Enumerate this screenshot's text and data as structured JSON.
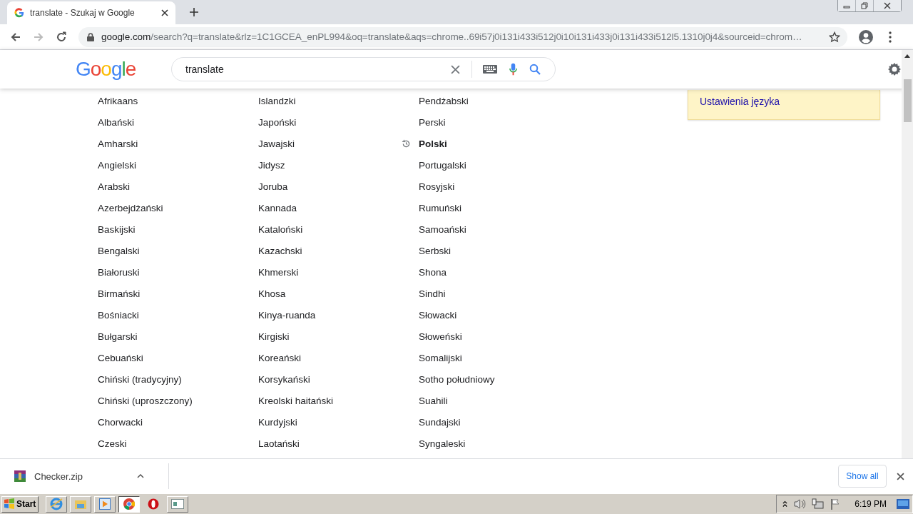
{
  "tab": {
    "title": "translate - Szukaj w Google"
  },
  "address": {
    "host": "google.com",
    "path": "/search?q=translate&rlz=1C1GCEA_enPL994&oq=translate&aqs=chrome..69i57j0i131i433i512j0i10i131i433j0i131i433i512l5.1310j0j4&sourceid=chrom…"
  },
  "logo": "Google",
  "search": {
    "value": "translate"
  },
  "languages": [
    [
      {
        "name": "Afrikaans",
        "selected": false
      },
      {
        "name": "Albański",
        "selected": false
      },
      {
        "name": "Amharski",
        "selected": false
      },
      {
        "name": "Angielski",
        "selected": false
      },
      {
        "name": "Arabski",
        "selected": false
      },
      {
        "name": "Azerbejdżański",
        "selected": false
      },
      {
        "name": "Baskijski",
        "selected": false
      },
      {
        "name": "Bengalski",
        "selected": false
      },
      {
        "name": "Białoruski",
        "selected": false
      },
      {
        "name": "Birmański",
        "selected": false
      },
      {
        "name": "Bośniacki",
        "selected": false
      },
      {
        "name": "Bułgarski",
        "selected": false
      },
      {
        "name": "Cebuański",
        "selected": false
      },
      {
        "name": "Chiński (tradycyjny)",
        "selected": false
      },
      {
        "name": "Chiński (uproszczony)",
        "selected": false
      },
      {
        "name": "Chorwacki",
        "selected": false
      },
      {
        "name": "Czeski",
        "selected": false
      }
    ],
    [
      {
        "name": "Islandzki",
        "selected": false
      },
      {
        "name": "Japoński",
        "selected": false
      },
      {
        "name": "Jawajski",
        "selected": false
      },
      {
        "name": "Jidysz",
        "selected": false
      },
      {
        "name": "Joruba",
        "selected": false
      },
      {
        "name": "Kannada",
        "selected": false
      },
      {
        "name": "Kataloński",
        "selected": false
      },
      {
        "name": "Kazachski",
        "selected": false
      },
      {
        "name": "Khmerski",
        "selected": false
      },
      {
        "name": "Khosa",
        "selected": false
      },
      {
        "name": "Kinya-ruanda",
        "selected": false
      },
      {
        "name": "Kirgiski",
        "selected": false
      },
      {
        "name": "Koreański",
        "selected": false
      },
      {
        "name": "Korsykański",
        "selected": false
      },
      {
        "name": "Kreolski haitański",
        "selected": false
      },
      {
        "name": "Kurdyjski",
        "selected": false
      },
      {
        "name": "Laotański",
        "selected": false
      }
    ],
    [
      {
        "name": "Pendżabski",
        "selected": false
      },
      {
        "name": "Perski",
        "selected": false
      },
      {
        "name": "Polski",
        "selected": true
      },
      {
        "name": "Portugalski",
        "selected": false
      },
      {
        "name": "Rosyjski",
        "selected": false
      },
      {
        "name": "Rumuński",
        "selected": false
      },
      {
        "name": "Samoański",
        "selected": false
      },
      {
        "name": "Serbski",
        "selected": false
      },
      {
        "name": "Shona",
        "selected": false
      },
      {
        "name": "Sindhi",
        "selected": false
      },
      {
        "name": "Słowacki",
        "selected": false
      },
      {
        "name": "Słoweński",
        "selected": false
      },
      {
        "name": "Somalijski",
        "selected": false
      },
      {
        "name": "Sotho południowy",
        "selected": false
      },
      {
        "name": "Suahili",
        "selected": false
      },
      {
        "name": "Sundajski",
        "selected": false
      },
      {
        "name": "Syngaleski",
        "selected": false
      }
    ]
  ],
  "language_settings_link": "Ustawienia języka",
  "download": {
    "file": "Checker.zip",
    "show_all": "Show all"
  },
  "taskbar": {
    "start": "Start",
    "time": "6:19 PM"
  }
}
